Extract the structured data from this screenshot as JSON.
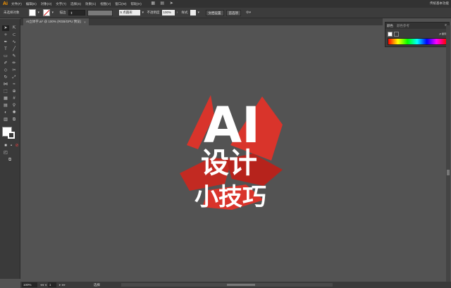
{
  "app": {
    "logo": "Ai",
    "workspace": "传统基本功能"
  },
  "menu": [
    "文件(F)",
    "编辑(E)",
    "对象(O)",
    "文字(T)",
    "选择(S)",
    "效果(C)",
    "视图(V)",
    "窗口(W)",
    "帮助(H)"
  ],
  "control": {
    "selection_label": "未选择对象",
    "stroke_label": "描边",
    "brush_value": "5 点圆形",
    "opacity_label": "不透明度",
    "opacity_value": "100%",
    "style_label": "样式",
    "doc_setup": "文档设置",
    "preferences": "首选项"
  },
  "document": {
    "tab_title": "AI立体字.ai* @ 100% (RGB/GPU 预览)",
    "close": "×"
  },
  "color_panel": {
    "tab_color": "颜色",
    "tab_guide": "颜色参考",
    "hex_label": "#",
    "hex_value": "ffffff"
  },
  "artwork": {
    "line1": "AI",
    "line2": "设计",
    "line3": "小技巧",
    "accent": "#d9342b"
  },
  "status": {
    "zoom": "100%",
    "page": "1",
    "tool": "选择"
  }
}
